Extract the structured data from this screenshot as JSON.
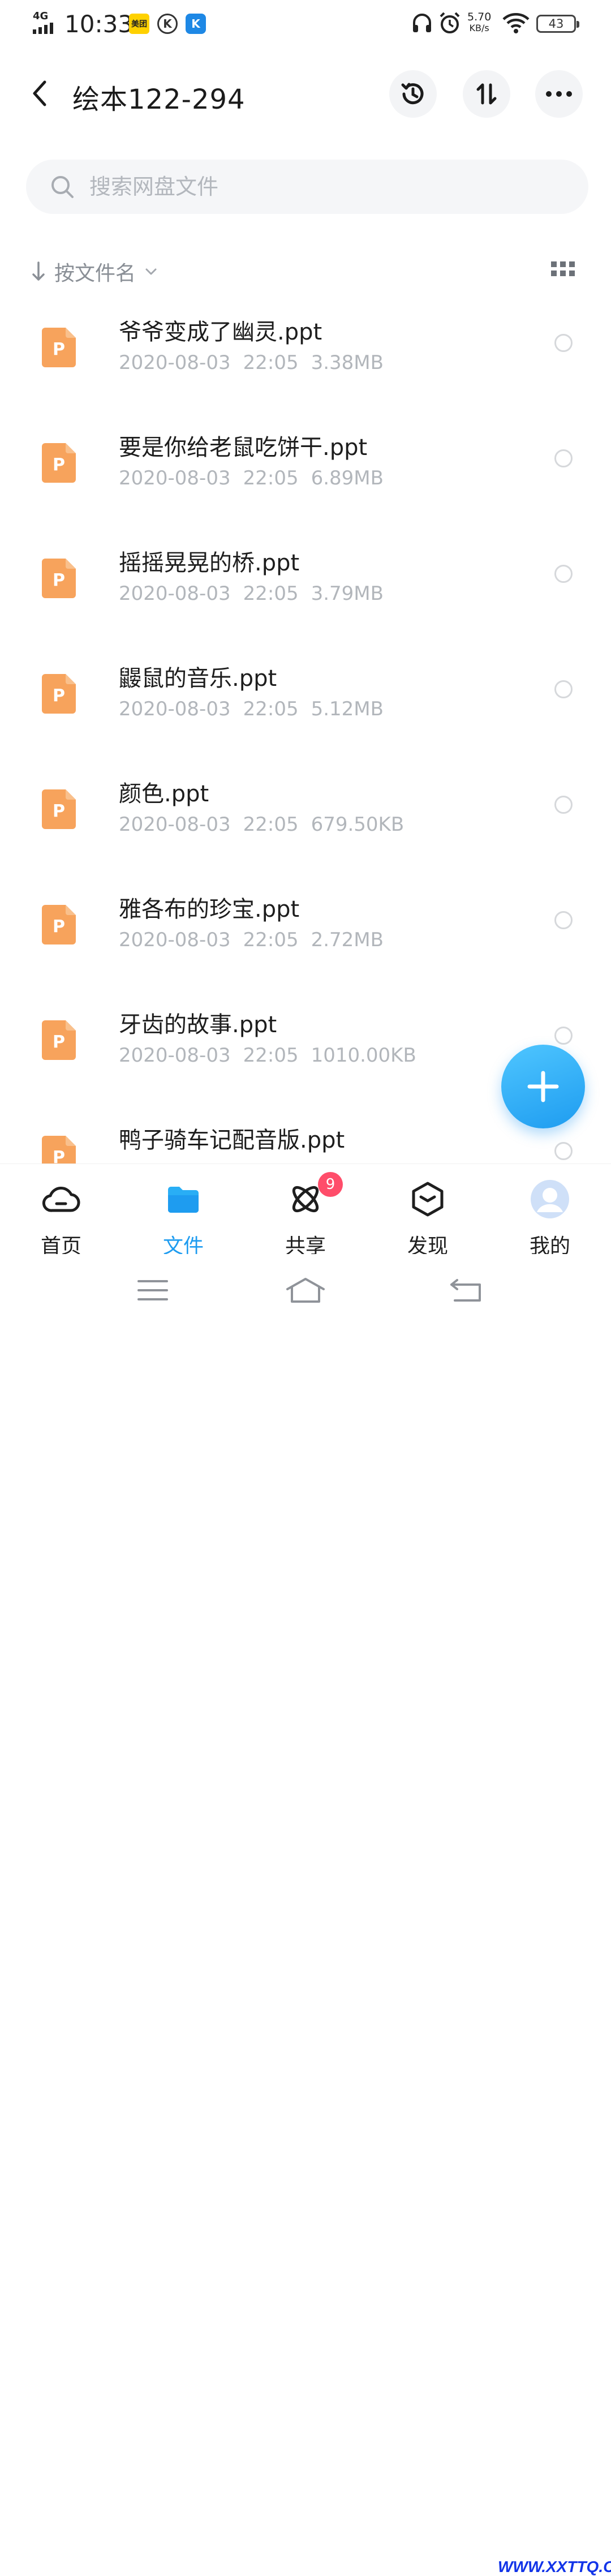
{
  "status_bar": {
    "network": "4G",
    "time": "10:33",
    "meituan_label": "美团",
    "k_label": "K",
    "speed_value": "5.70",
    "speed_unit": "KB/s",
    "battery": "43"
  },
  "header": {
    "title": "绘本122-294"
  },
  "search": {
    "placeholder": "搜索网盘文件"
  },
  "sort": {
    "label": "按文件名"
  },
  "files": [
    {
      "name": "爷爷变成了幽灵.ppt",
      "date": "2020-08-03",
      "time": "22:05",
      "size": "3.38MB"
    },
    {
      "name": "要是你给老鼠吃饼干.ppt",
      "date": "2020-08-03",
      "time": "22:05",
      "size": "6.89MB"
    },
    {
      "name": "摇摇晃晃的桥.ppt",
      "date": "2020-08-03",
      "time": "22:05",
      "size": "3.79MB"
    },
    {
      "name": "鼹鼠的音乐.ppt",
      "date": "2020-08-03",
      "time": "22:05",
      "size": "5.12MB"
    },
    {
      "name": "颜色.ppt",
      "date": "2020-08-03",
      "time": "22:05",
      "size": "679.50KB"
    },
    {
      "name": "雅各布的珍宝.ppt",
      "date": "2020-08-03",
      "time": "22:05",
      "size": "2.72MB"
    },
    {
      "name": "牙齿的故事.ppt",
      "date": "2020-08-03",
      "time": "22:05",
      "size": "1010.00KB"
    },
    {
      "name": "鸭子骑车记配音版.ppt",
      "date": "",
      "time": "",
      "size": ""
    }
  ],
  "file_icon_letter": "P",
  "nav": {
    "home": "首页",
    "files": "文件",
    "share": "共享",
    "share_badge": "9",
    "discover": "发现",
    "me": "我的"
  },
  "colors": {
    "accent": "#1e9cf0",
    "ppt_icon": "#f7a35c",
    "badge": "#ff4d6a"
  },
  "watermark": "WWW.XXTTQ.COM"
}
